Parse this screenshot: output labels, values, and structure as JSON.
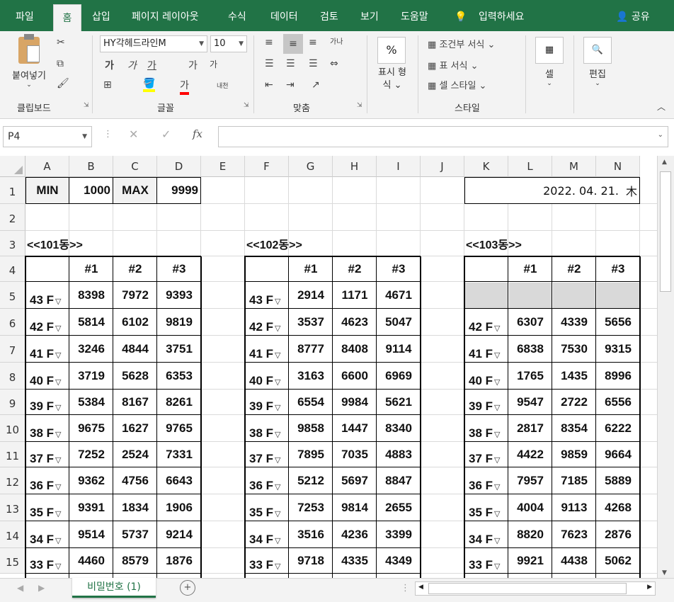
{
  "tabs": [
    "파일",
    "홈",
    "삽입",
    "페이지 레이아웃",
    "수식",
    "데이터",
    "검토",
    "보기",
    "도움말"
  ],
  "tell_me": "입력하세요",
  "share": "공유",
  "clipboard": {
    "paste": "붙여넣기",
    "label": "클립보드"
  },
  "font": {
    "name": "HY각헤드라인M",
    "size": "10",
    "label": "글꼴",
    "bold": "가",
    "italic": "가",
    "underline": "가",
    "grow": "가",
    "shrink": "가",
    "color": "가",
    "phonetic": "내천"
  },
  "align": {
    "label": "맞춤",
    "wrap": "가나"
  },
  "number": {
    "label1": "표시 형",
    "label2": "식",
    "icon": "%"
  },
  "styles": {
    "cond": "조건부 서식",
    "table": "표 서식",
    "cell": "셀 스타일",
    "label": "스타일"
  },
  "cells": {
    "label": "셀"
  },
  "edit": {
    "label": "편집"
  },
  "namebox": "P4",
  "fx": "fx",
  "columns": [
    "A",
    "B",
    "C",
    "D",
    "E",
    "F",
    "G",
    "H",
    "I",
    "J",
    "K",
    "L",
    "M",
    "N"
  ],
  "rows": [
    "1",
    "2",
    "3",
    "4",
    "5",
    "6",
    "7",
    "8",
    "9",
    "10",
    "11",
    "12",
    "13",
    "14",
    "15"
  ],
  "row1": {
    "min_label": "MIN",
    "min_val": "1000",
    "max_label": "MAX",
    "max_val": "9999",
    "date": "2022. 04. 21.",
    "weekday": "木"
  },
  "blocks": [
    {
      "title": "<<101동>>",
      "headers": [
        "#1",
        "#2",
        "#3"
      ],
      "floors": [
        "43 F",
        "42 F",
        "41 F",
        "40 F",
        "39 F",
        "38 F",
        "37 F",
        "36 F",
        "35 F",
        "34 F",
        "33 F"
      ],
      "values": [
        [
          "8398",
          "7972",
          "9393"
        ],
        [
          "5814",
          "6102",
          "9819"
        ],
        [
          "3246",
          "4844",
          "3751"
        ],
        [
          "3719",
          "5628",
          "6353"
        ],
        [
          "5384",
          "8167",
          "8261"
        ],
        [
          "9675",
          "1627",
          "9765"
        ],
        [
          "7252",
          "2524",
          "7331"
        ],
        [
          "9362",
          "4756",
          "6643"
        ],
        [
          "9391",
          "1834",
          "1906"
        ],
        [
          "9514",
          "5737",
          "9214"
        ],
        [
          "4460",
          "8579",
          "1876"
        ]
      ]
    },
    {
      "title": "<<102동>>",
      "headers": [
        "#1",
        "#2",
        "#3"
      ],
      "floors": [
        "43 F",
        "42 F",
        "41 F",
        "40 F",
        "39 F",
        "38 F",
        "37 F",
        "36 F",
        "35 F",
        "34 F",
        "33 F"
      ],
      "values": [
        [
          "2914",
          "1171",
          "4671"
        ],
        [
          "3537",
          "4623",
          "5047"
        ],
        [
          "8777",
          "8408",
          "9114"
        ],
        [
          "3163",
          "6600",
          "6969"
        ],
        [
          "6554",
          "9984",
          "5621"
        ],
        [
          "9858",
          "1447",
          "8340"
        ],
        [
          "7895",
          "7035",
          "4883"
        ],
        [
          "5212",
          "5697",
          "8847"
        ],
        [
          "7253",
          "9814",
          "2655"
        ],
        [
          "3516",
          "4236",
          "3399"
        ],
        [
          "9718",
          "4335",
          "4349"
        ]
      ]
    },
    {
      "title": "<<103동>>",
      "headers": [
        "#1",
        "#2",
        "#3"
      ],
      "floors": [
        "",
        "42 F",
        "41 F",
        "40 F",
        "39 F",
        "38 F",
        "37 F",
        "36 F",
        "35 F",
        "34 F",
        "33 F"
      ],
      "values": [
        [
          "",
          "",
          ""
        ],
        [
          "6307",
          "4339",
          "5656"
        ],
        [
          "6838",
          "7530",
          "9315"
        ],
        [
          "1765",
          "1435",
          "8996"
        ],
        [
          "9547",
          "2722",
          "6556"
        ],
        [
          "2817",
          "8354",
          "6222"
        ],
        [
          "4422",
          "9859",
          "9664"
        ],
        [
          "7957",
          "7185",
          "5889"
        ],
        [
          "4004",
          "9113",
          "4268"
        ],
        [
          "8820",
          "7623",
          "2876"
        ],
        [
          "9921",
          "4438",
          "5062"
        ]
      ]
    }
  ],
  "sheet_tab": "비밀번호 (1)",
  "colors": {
    "brand": "#217346",
    "gray_fill": "#d9d9d9"
  }
}
